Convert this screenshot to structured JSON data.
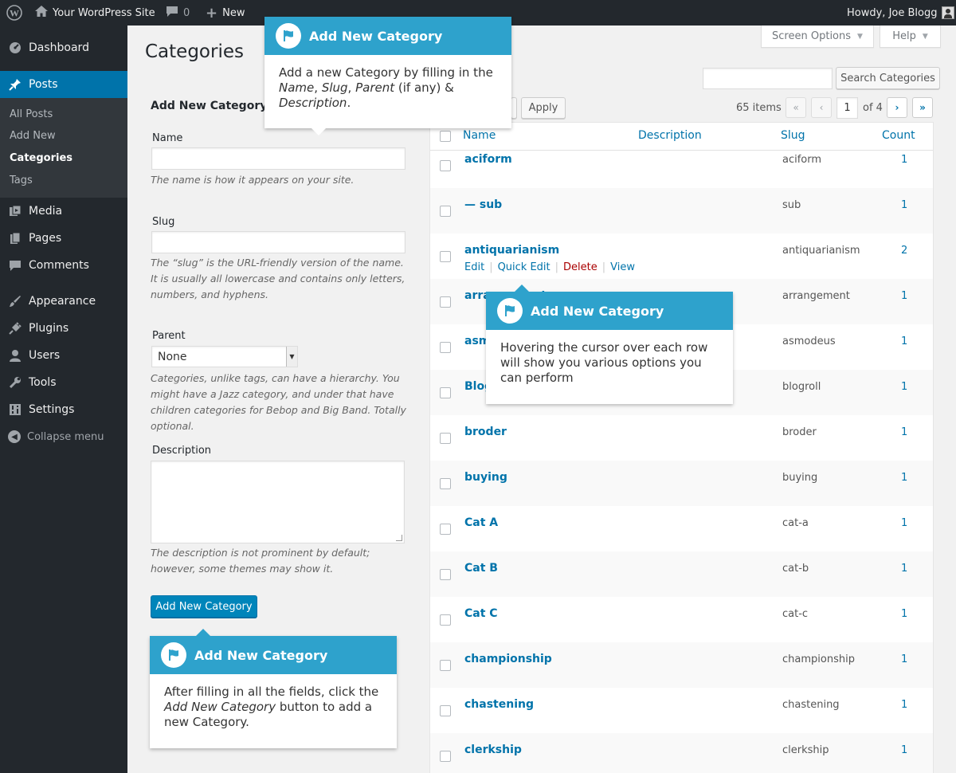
{
  "admin_bar": {
    "site_name": "Your WordPress Site",
    "comments_count": "0",
    "new_label": "New",
    "howdy": "Howdy, Joe Blogg"
  },
  "menu": {
    "dashboard": "Dashboard",
    "posts": "Posts",
    "sub": [
      "All Posts",
      "Add New",
      "Categories",
      "Tags"
    ],
    "media": "Media",
    "pages": "Pages",
    "comments": "Comments",
    "appearance": "Appearance",
    "plugins": "Plugins",
    "users": "Users",
    "tools": "Tools",
    "settings": "Settings",
    "collapse": "Collapse menu"
  },
  "screen_options": "Screen Options",
  "help": "Help",
  "page_title": "Categories",
  "form": {
    "heading": "Add New Category",
    "name_label": "Name",
    "name_help": "The name is how it appears on your site.",
    "slug_label": "Slug",
    "slug_help": "The “slug” is the URL-friendly version of the name. It is usually all lowercase and contains only letters, numbers, and hyphens.",
    "parent_label": "Parent",
    "parent_value": "None",
    "parent_help": "Categories, unlike tags, can have a hierarchy. You might have a Jazz category, and under that have children categories for Bebop and Big Band. Totally optional.",
    "desc_label": "Description",
    "desc_help": "The description is not prominent by default; however, some themes may show it.",
    "submit": "Add New Category"
  },
  "search_button": "Search Categories",
  "apply_button": "Apply",
  "pagination": {
    "items": "65 items",
    "first": "«",
    "prev": "‹",
    "current": "1",
    "of": "of 4",
    "next": "›",
    "last": "»"
  },
  "table": {
    "headers": {
      "name": "Name",
      "description": "Description",
      "slug": "Slug",
      "count": "Count"
    },
    "rows": [
      {
        "name": "aciform",
        "slug": "aciform",
        "count": "1"
      },
      {
        "name": "— sub",
        "slug": "sub",
        "count": "1"
      },
      {
        "name": "antiquarianism",
        "slug": "antiquarianism",
        "count": "2"
      },
      {
        "name": "arrangement",
        "slug": "arrangement",
        "count": "1"
      },
      {
        "name": "asmodeus",
        "slug": "asmodeus",
        "count": "1"
      },
      {
        "name": "Blogroll",
        "slug": "blogroll",
        "count": "1"
      },
      {
        "name": "broder",
        "slug": "broder",
        "count": "1"
      },
      {
        "name": "buying",
        "slug": "buying",
        "count": "1"
      },
      {
        "name": "Cat A",
        "slug": "cat-a",
        "count": "1"
      },
      {
        "name": "Cat B",
        "slug": "cat-b",
        "count": "1"
      },
      {
        "name": "Cat C",
        "slug": "cat-c",
        "count": "1"
      },
      {
        "name": "championship",
        "slug": "championship",
        "count": "1"
      },
      {
        "name": "chastening",
        "slug": "chastening",
        "count": "1"
      },
      {
        "name": "clerkship",
        "slug": "clerkship",
        "count": "1"
      }
    ],
    "row_actions": {
      "edit": "Edit",
      "quick_edit": "Quick Edit",
      "delete": "Delete",
      "view": "View"
    }
  },
  "tips": [
    {
      "title": "Add New Category",
      "b1": "Add a new Category by filling in the ",
      "e1": "Name",
      "b2": ", ",
      "e2": "Slug",
      "b3": ", ",
      "e3": "Parent",
      "b4": " (if any) & ",
      "e4": "Description",
      "b5": "."
    },
    {
      "title": "Add New Category",
      "body": "Hovering the cursor over each row will show you various options you can perform"
    },
    {
      "title": "Add New Category",
      "b1": "After filling in all the fields, click the ",
      "e1": "Add New Category",
      "b2": " button to add a new Category."
    }
  ],
  "colors": {
    "accent": "#0073aa",
    "tip_header": "#2ea2cc",
    "menu_bg": "#23282d",
    "delete": "#a00"
  }
}
